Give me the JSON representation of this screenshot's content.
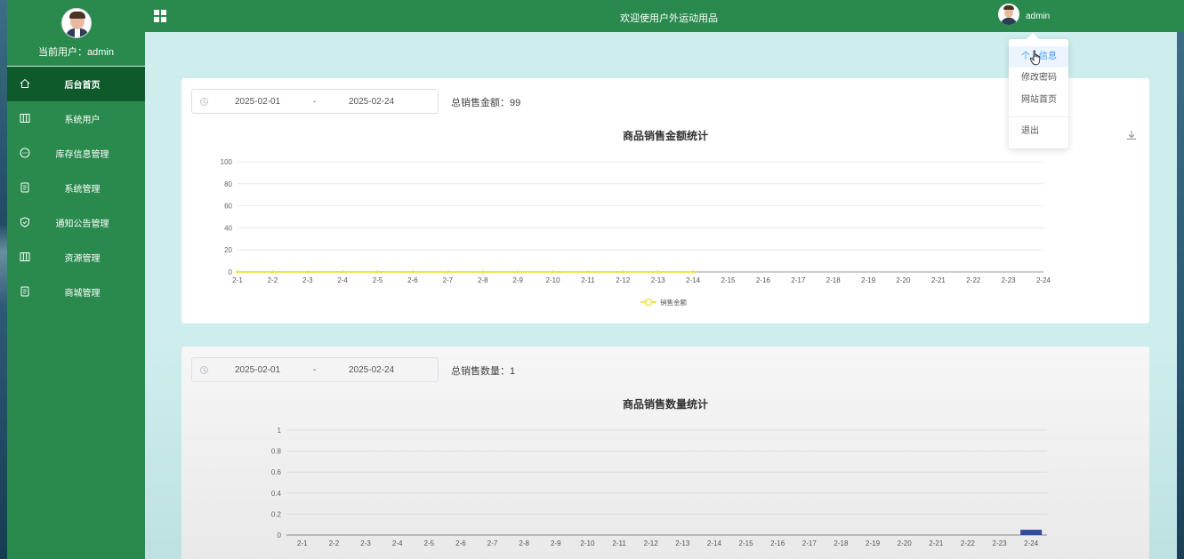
{
  "sidebar": {
    "current_user_label": "当前用户：admin",
    "items": [
      {
        "label": "后台首页",
        "icon": "home-icon",
        "active": true
      },
      {
        "label": "系统用户",
        "icon": "columns-icon",
        "active": false
      },
      {
        "label": "库存信息管理",
        "icon": "chat-icon",
        "active": false
      },
      {
        "label": "系统管理",
        "icon": "document-icon",
        "active": false
      },
      {
        "label": "通知公告管理",
        "icon": "shield-icon",
        "active": false
      },
      {
        "label": "资源管理",
        "icon": "columns-icon",
        "active": false
      },
      {
        "label": "商城管理",
        "icon": "document-icon",
        "active": false
      }
    ]
  },
  "header": {
    "title": "欢迎使用户外运动用品",
    "username": "admin"
  },
  "dropdown": {
    "items": [
      "个人信息",
      "修改密码",
      "网站首页",
      "退出"
    ],
    "hovered_index": 0
  },
  "sales_amount": {
    "date_start": "2025-02-01",
    "date_sep": "-",
    "date_end": "2025-02-24",
    "total_label": "总销售金额：99"
  },
  "sales_quantity": {
    "date_start": "2025-02-01",
    "date_sep": "-",
    "date_end": "2025-02-24",
    "total_label": "总销售数量：1"
  },
  "chart_data": [
    {
      "type": "line",
      "title": "商品销售金额统计",
      "categories": [
        "2-1",
        "2-2",
        "2-3",
        "2-4",
        "2-5",
        "2-6",
        "2-7",
        "2-8",
        "2-9",
        "2-10",
        "2-11",
        "2-12",
        "2-13",
        "2-14",
        "2-15",
        "2-16",
        "2-17",
        "2-18",
        "2-19",
        "2-20",
        "2-21",
        "2-22",
        "2-23",
        "2-24"
      ],
      "series": [
        {
          "name": "销售金额",
          "values": [
            0,
            0,
            0,
            0,
            0,
            0,
            0,
            0,
            0,
            0,
            0,
            0,
            0,
            0,
            null,
            null,
            null,
            null,
            null,
            null,
            null,
            null,
            null,
            null
          ],
          "color": "#f5e14a"
        }
      ],
      "yticks": [
        0,
        20,
        40,
        60,
        80,
        100
      ],
      "ylim": [
        0,
        100
      ],
      "grid": true,
      "legend": "bottom-center"
    },
    {
      "type": "bar",
      "title": "商品销售数量统计",
      "categories": [
        "2-1",
        "2-2",
        "2-3",
        "2-4",
        "2-5",
        "2-6",
        "2-7",
        "2-8",
        "2-9",
        "2-10",
        "2-11",
        "2-12",
        "2-13",
        "2-14",
        "2-15",
        "2-16",
        "2-17",
        "2-18",
        "2-19",
        "2-20",
        "2-21",
        "2-22",
        "2-23",
        "2-24"
      ],
      "values": [
        0,
        0,
        0,
        0,
        0,
        0,
        0,
        0,
        0,
        0,
        0,
        0,
        0,
        0,
        0,
        0,
        0,
        0,
        0,
        0,
        0,
        0,
        0,
        0.05
      ],
      "color": "#2f4a9e",
      "yticks": [
        0,
        0.2,
        0.4,
        0.6,
        0.8,
        1
      ],
      "ylim": [
        0,
        1
      ],
      "grid": true
    }
  ],
  "colors": {
    "sidebar": "#2a8a4e",
    "sidebar_active": "#0f5a2b",
    "main_bg": "#cdeeed",
    "accent": "#409eff"
  }
}
